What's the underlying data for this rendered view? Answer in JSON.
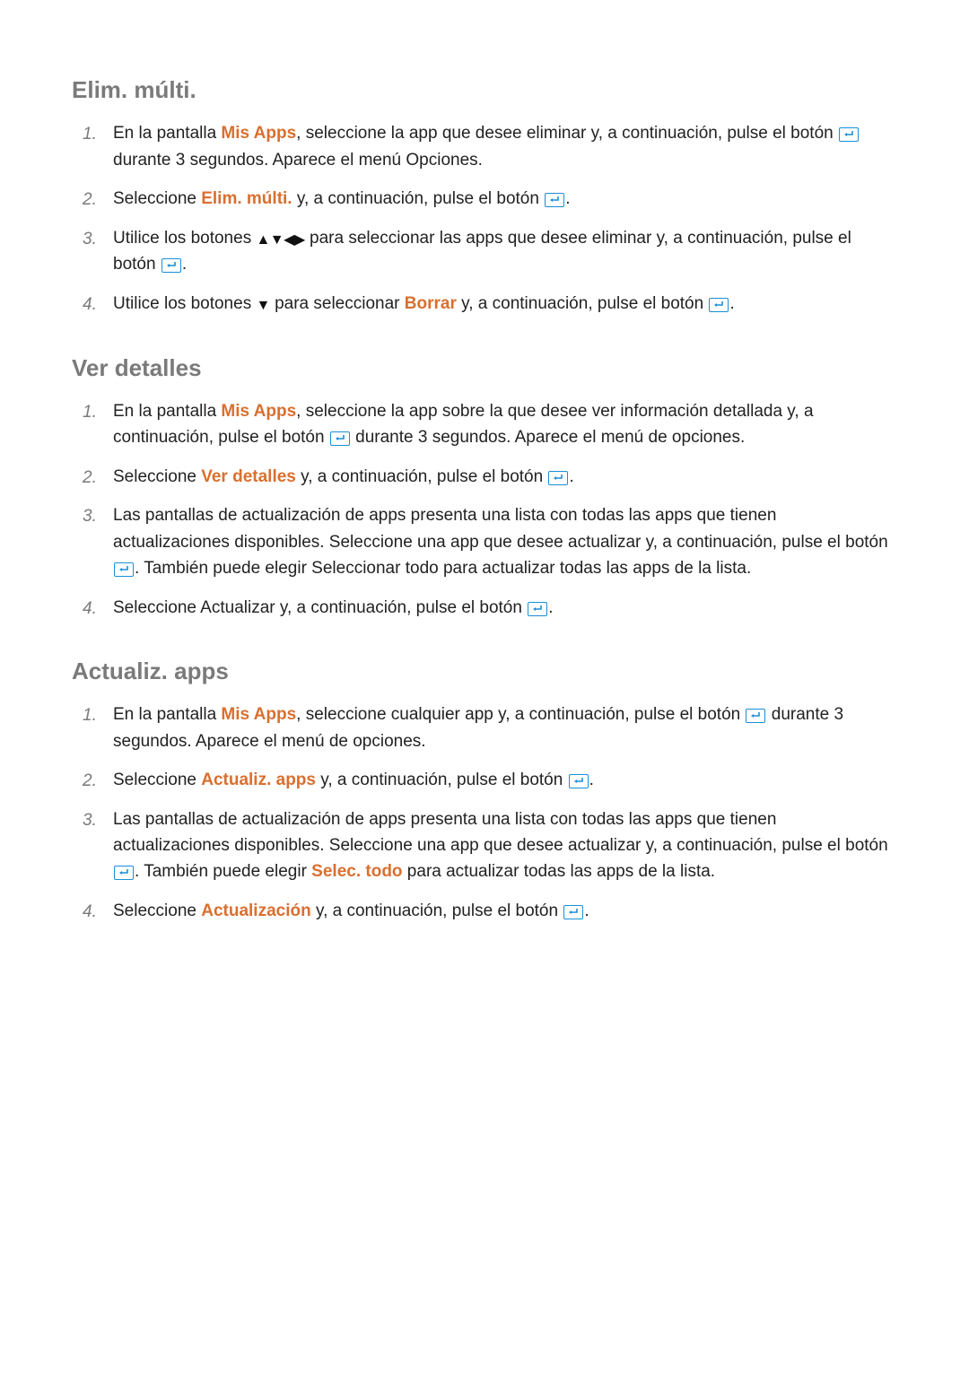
{
  "sections": [
    {
      "title": "Elim. múlti.",
      "items": [
        {
          "tokens": [
            {
              "t": "En la pantalla "
            },
            {
              "hl": "Mis Apps"
            },
            {
              "t": ", seleccione la app que desee eliminar y, a continuación, pulse el botón "
            },
            {
              "enter": true
            },
            {
              "t": " durante 3 segundos. Aparece el menú Opciones."
            }
          ]
        },
        {
          "tokens": [
            {
              "t": "Seleccione "
            },
            {
              "hl": "Elim. múlti."
            },
            {
              "t": " y, a continuación, pulse el botón "
            },
            {
              "enter": true
            },
            {
              "t": "."
            }
          ]
        },
        {
          "tokens": [
            {
              "t": "Utilice los botones "
            },
            {
              "arrows": "▲▼◀▶"
            },
            {
              "t": " para seleccionar las apps que desee eliminar y, a continuación, pulse el botón "
            },
            {
              "enter": true
            },
            {
              "t": "."
            }
          ]
        },
        {
          "tokens": [
            {
              "t": "Utilice los botones "
            },
            {
              "arrows": "▼"
            },
            {
              "t": " para seleccionar "
            },
            {
              "hl": "Borrar"
            },
            {
              "t": " y, a continuación, pulse el botón "
            },
            {
              "enter": true
            },
            {
              "t": "."
            }
          ]
        }
      ]
    },
    {
      "title": "Ver detalles",
      "items": [
        {
          "tokens": [
            {
              "t": "En la pantalla "
            },
            {
              "hl": "Mis Apps"
            },
            {
              "t": ", seleccione la app sobre la que desee ver información detallada y, a continuación, pulse el botón "
            },
            {
              "enter": true
            },
            {
              "t": " durante 3 segundos. Aparece el menú de opciones."
            }
          ]
        },
        {
          "tokens": [
            {
              "t": "Seleccione "
            },
            {
              "hl": "Ver detalles"
            },
            {
              "t": " y, a continuación, pulse el botón "
            },
            {
              "enter": true
            },
            {
              "t": "."
            }
          ]
        },
        {
          "tokens": [
            {
              "t": "Las pantallas de actualización de apps presenta una lista con todas las apps que tienen actualizaciones disponibles. Seleccione una app que desee actualizar y, a continuación, pulse el botón "
            },
            {
              "enter": true
            },
            {
              "t": ". También puede elegir Seleccionar todo para actualizar todas las apps de la lista."
            }
          ]
        },
        {
          "tokens": [
            {
              "t": "Seleccione Actualizar y, a continuación, pulse el botón "
            },
            {
              "enter": true
            },
            {
              "t": "."
            }
          ]
        }
      ]
    },
    {
      "title": "Actualiz. apps",
      "items": [
        {
          "tokens": [
            {
              "t": "En la pantalla "
            },
            {
              "hl": "Mis Apps"
            },
            {
              "t": ", seleccione cualquier app y, a continuación, pulse el botón "
            },
            {
              "enter": true
            },
            {
              "t": " durante 3 segundos. Aparece el menú de opciones."
            }
          ]
        },
        {
          "tokens": [
            {
              "t": "Seleccione "
            },
            {
              "hl": "Actualiz. apps"
            },
            {
              "t": " y, a continuación, pulse el botón "
            },
            {
              "enter": true
            },
            {
              "t": "."
            }
          ]
        },
        {
          "tokens": [
            {
              "t": "Las pantallas de actualización de apps presenta una lista con todas las apps que tienen actualizaciones disponibles. Seleccione una app que desee actualizar y, a continuación, pulse el botón "
            },
            {
              "enter": true
            },
            {
              "t": ". También puede elegir "
            },
            {
              "hl": "Selec. todo"
            },
            {
              "t": " para actualizar todas las apps de la lista."
            }
          ]
        },
        {
          "tokens": [
            {
              "t": "Seleccione "
            },
            {
              "hl": "Actualización"
            },
            {
              "t": " y, a continuación, pulse el botón "
            },
            {
              "enter": true
            },
            {
              "t": "."
            }
          ]
        }
      ]
    }
  ]
}
